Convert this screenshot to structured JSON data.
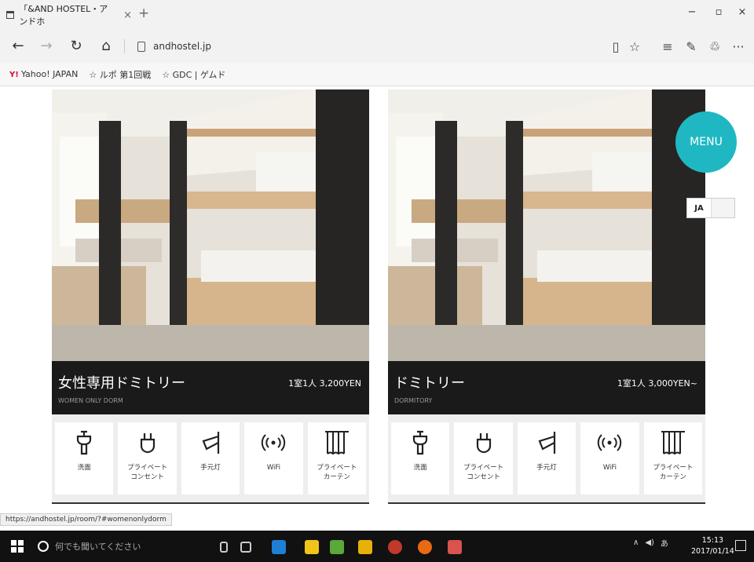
{
  "browser": {
    "tab_title": "「&AND HOSTEL・アンドホ",
    "tab_close": "×",
    "new_tab": "+",
    "url": "andhostel.jp",
    "window_minimize": "−",
    "window_maximize": "▫",
    "window_close": "×",
    "nav": {
      "back": "←",
      "forward": "→",
      "refresh": "↻",
      "home": "⌂"
    },
    "toolbar_icons": [
      "reading-view-icon",
      "favorites-star-icon",
      "hub-icon",
      "note-icon",
      "share-icon",
      "more-icon"
    ]
  },
  "bookmarks": [
    {
      "label": "Yahoo! JAPAN",
      "icon": "yahoo-icon"
    },
    {
      "label": "ルポ 第1回戦",
      "icon": "star-icon"
    },
    {
      "label": "GDC | ゲムド",
      "icon": "star-icon"
    }
  ],
  "site": {
    "menu_label": "MENU",
    "menu_color": "#1fb8c2",
    "lang_current": "JA"
  },
  "rooms": [
    {
      "title": "女性専用ドミトリー",
      "subtitle": "WOMEN ONLY DORM",
      "price": "1室1人 3,200YEN",
      "amenities": [
        {
          "icon": "washbasin-icon",
          "label": "洗面"
        },
        {
          "icon": "outlet-icon",
          "label": "プライベート\nコンセント"
        },
        {
          "icon": "reading-light-icon",
          "label": "手元灯"
        },
        {
          "icon": "wifi-icon",
          "label": "WiFi"
        },
        {
          "icon": "curtain-icon",
          "label": "プライベート\nカーテン"
        }
      ]
    },
    {
      "title": "ドミトリー",
      "subtitle": "DORMITORY",
      "price": "1室1人 3,000YEN~",
      "amenities": [
        {
          "icon": "washbasin-icon",
          "label": "洗面"
        },
        {
          "icon": "outlet-icon",
          "label": "プライベート\nコンセント"
        },
        {
          "icon": "reading-light-icon",
          "label": "手元灯"
        },
        {
          "icon": "wifi-icon",
          "label": "WiFi"
        },
        {
          "icon": "curtain-icon",
          "label": "プライベート\nカーテン"
        }
      ]
    }
  ],
  "status_url": "https://andhostel.jp/room/?#womenonlydorm",
  "taskbar": {
    "search_placeholder": "何でも聞いてください",
    "time": "15:13",
    "date": "2017/01/14"
  }
}
